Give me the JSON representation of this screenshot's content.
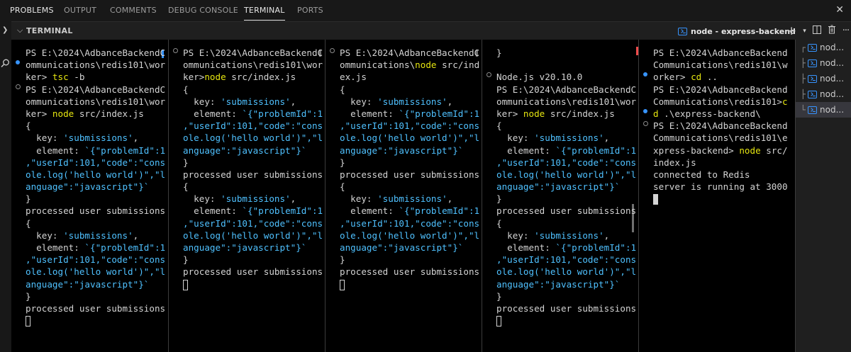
{
  "tabs": [
    "PROBLEMS",
    "OUTPUT",
    "COMMENTS",
    "DEBUG CONSOLE",
    "TERMINAL",
    "PORTS"
  ],
  "active_tab": "TERMINAL",
  "panel_title": "TERMINAL",
  "active_terminal": "node - express-backend",
  "terminal_list": [
    "nod...",
    "nod...",
    "nod...",
    "nod...",
    "nod..."
  ],
  "colors": {
    "accent": "#3794ff",
    "command": "#e5e510",
    "string": "#4fc1ff",
    "background": "#000000"
  },
  "panes": [
    {
      "lines": [
        [
          [
            "PS E:\\2024\\AdbanceBackendC",
            ""
          ]
        ],
        [
          [
            "ommunications\\redis101\\wor",
            ""
          ]
        ],
        [
          [
            "ker> ",
            ""
          ],
          [
            "tsc",
            "y"
          ],
          [
            " -b",
            ""
          ]
        ],
        [
          [
            "PS E:\\2024\\AdbanceBackendC",
            ""
          ]
        ],
        [
          [
            "ommunications\\redis101\\wor",
            ""
          ]
        ],
        [
          [
            "ker> ",
            ""
          ],
          [
            "node",
            "y"
          ],
          [
            " src/index.js",
            ""
          ]
        ],
        [
          [
            "{",
            ""
          ]
        ],
        [
          [
            "  key: ",
            ""
          ],
          [
            "'submissions'",
            "s"
          ],
          [
            ",",
            ""
          ]
        ],
        [
          [
            "  element: ",
            ""
          ],
          [
            "`{\"problemId\":1",
            "s"
          ]
        ],
        [
          [
            ",\"userId\":101,\"code\":\"cons",
            "s"
          ]
        ],
        [
          [
            "ole.log('hello world')\",\"l",
            "s"
          ]
        ],
        [
          [
            "anguage\":\"javascript\"}`",
            "s"
          ]
        ],
        [
          [
            "}",
            ""
          ]
        ],
        [
          [
            "processed user submissions",
            ""
          ]
        ],
        [
          [
            "{",
            ""
          ]
        ],
        [
          [
            "  key: ",
            ""
          ],
          [
            "'submissions'",
            "s"
          ],
          [
            ",",
            ""
          ]
        ],
        [
          [
            "  element: ",
            ""
          ],
          [
            "`{\"problemId\":1",
            "s"
          ]
        ],
        [
          [
            ",\"userId\":101,\"code\":\"cons",
            "s"
          ]
        ],
        [
          [
            "ole.log('hello world')\",\"l",
            "s"
          ]
        ],
        [
          [
            "anguage\":\"javascript\"}`",
            "s"
          ]
        ],
        [
          [
            "}",
            ""
          ]
        ],
        [
          [
            "processed user submissions",
            ""
          ]
        ]
      ]
    },
    {
      "lines": [
        [
          [
            "PS E:\\2024\\AdbanceBackendC",
            ""
          ]
        ],
        [
          [
            "ommunications\\redis101\\wor",
            ""
          ]
        ],
        [
          [
            "ker>",
            ""
          ],
          [
            "node",
            "y"
          ],
          [
            " src/index.js",
            ""
          ]
        ],
        [
          [
            "{",
            ""
          ]
        ],
        [
          [
            "  key: ",
            ""
          ],
          [
            "'submissions'",
            "s"
          ],
          [
            ",",
            ""
          ]
        ],
        [
          [
            "  element: ",
            ""
          ],
          [
            "`{\"problemId\":1",
            "s"
          ]
        ],
        [
          [
            ",\"userId\":101,\"code\":\"cons",
            "s"
          ]
        ],
        [
          [
            "ole.log('hello world')\",\"l",
            "s"
          ]
        ],
        [
          [
            "anguage\":\"javascript\"}`",
            "s"
          ]
        ],
        [
          [
            "}",
            ""
          ]
        ],
        [
          [
            "processed user submissions",
            ""
          ]
        ],
        [
          [
            "{",
            ""
          ]
        ],
        [
          [
            "  key: ",
            ""
          ],
          [
            "'submissions'",
            "s"
          ],
          [
            ",",
            ""
          ]
        ],
        [
          [
            "  element: ",
            ""
          ],
          [
            "`{\"problemId\":1",
            "s"
          ]
        ],
        [
          [
            ",\"userId\":101,\"code\":\"cons",
            "s"
          ]
        ],
        [
          [
            "ole.log('hello world')\",\"l",
            "s"
          ]
        ],
        [
          [
            "anguage\":\"javascript\"}`",
            "s"
          ]
        ],
        [
          [
            "}",
            ""
          ]
        ],
        [
          [
            "processed user submissions",
            ""
          ]
        ]
      ]
    },
    {
      "lines": [
        [
          [
            "PS E:\\2024\\AdbanceBackendC",
            ""
          ]
        ],
        [
          [
            "ommunications\\",
            ""
          ],
          [
            "node",
            "y"
          ],
          [
            " src/ind",
            ""
          ]
        ],
        [
          [
            "ex.js",
            ""
          ]
        ],
        [
          [
            "{",
            ""
          ]
        ],
        [
          [
            "  key: ",
            ""
          ],
          [
            "'submissions'",
            "s"
          ],
          [
            ",",
            ""
          ]
        ],
        [
          [
            "  element: ",
            ""
          ],
          [
            "`{\"problemId\":1",
            "s"
          ]
        ],
        [
          [
            ",\"userId\":101,\"code\":\"cons",
            "s"
          ]
        ],
        [
          [
            "ole.log('hello world')\",\"l",
            "s"
          ]
        ],
        [
          [
            "anguage\":\"javascript\"}`",
            "s"
          ]
        ],
        [
          [
            "}",
            ""
          ]
        ],
        [
          [
            "processed user submissions",
            ""
          ]
        ],
        [
          [
            "{",
            ""
          ]
        ],
        [
          [
            "  key: ",
            ""
          ],
          [
            "'submissions'",
            "s"
          ],
          [
            ",",
            ""
          ]
        ],
        [
          [
            "  element: ",
            ""
          ],
          [
            "`{\"problemId\":1",
            "s"
          ]
        ],
        [
          [
            ",\"userId\":101,\"code\":\"cons",
            "s"
          ]
        ],
        [
          [
            "ole.log('hello world')\",\"l",
            "s"
          ]
        ],
        [
          [
            "anguage\":\"javascript\"}`",
            "s"
          ]
        ],
        [
          [
            "}",
            ""
          ]
        ],
        [
          [
            "processed user submissions",
            ""
          ]
        ]
      ]
    },
    {
      "lines": [
        [
          [
            "}",
            ""
          ]
        ],
        [
          [
            "",
            ""
          ]
        ],
        [
          [
            "Node.js v20.10.0",
            ""
          ]
        ],
        [
          [
            "PS E:\\2024\\AdbanceBackendC",
            ""
          ]
        ],
        [
          [
            "ommunications\\redis101\\wor",
            ""
          ]
        ],
        [
          [
            "ker> ",
            ""
          ],
          [
            "node",
            "y"
          ],
          [
            " src/index.js",
            ""
          ]
        ],
        [
          [
            "{",
            ""
          ]
        ],
        [
          [
            "  key: ",
            ""
          ],
          [
            "'submissions'",
            "s"
          ],
          [
            ",",
            ""
          ]
        ],
        [
          [
            "  element: ",
            ""
          ],
          [
            "`{\"problemId\":1",
            "s"
          ]
        ],
        [
          [
            ",\"userId\":101,\"code\":\"cons",
            "s"
          ]
        ],
        [
          [
            "ole.log('hello world')\",\"l",
            "s"
          ]
        ],
        [
          [
            "anguage\":\"javascript\"}`",
            "s"
          ]
        ],
        [
          [
            "}",
            ""
          ]
        ],
        [
          [
            "processed user submissions",
            ""
          ]
        ],
        [
          [
            "{",
            ""
          ]
        ],
        [
          [
            "  key: ",
            ""
          ],
          [
            "'submissions'",
            "s"
          ],
          [
            ",",
            ""
          ]
        ],
        [
          [
            "  element: ",
            ""
          ],
          [
            "`{\"problemId\":1",
            "s"
          ]
        ],
        [
          [
            ",\"userId\":101,\"code\":\"cons",
            "s"
          ]
        ],
        [
          [
            "ole.log('hello world')\",\"l",
            "s"
          ]
        ],
        [
          [
            "anguage\":\"javascript\"}`",
            "s"
          ]
        ],
        [
          [
            "}",
            ""
          ]
        ],
        [
          [
            "processed user submissions",
            ""
          ]
        ]
      ]
    },
    {
      "lines": [
        [
          [
            "PS E:\\2024\\AdbanceBackend",
            ""
          ]
        ],
        [
          [
            "Communications\\redis101\\w",
            ""
          ]
        ],
        [
          [
            "orker> ",
            ""
          ],
          [
            "cd",
            "y"
          ],
          [
            " ..",
            ""
          ]
        ],
        [
          [
            "PS E:\\2024\\AdbanceBackend",
            ""
          ]
        ],
        [
          [
            "Communications\\redis101>",
            ""
          ],
          [
            "c",
            "y"
          ]
        ],
        [
          [
            "d",
            "y"
          ],
          [
            " .\\express-backend\\",
            ""
          ]
        ],
        [
          [
            "PS E:\\2024\\AdbanceBackend",
            ""
          ]
        ],
        [
          [
            "Communications\\redis101\\e",
            ""
          ]
        ],
        [
          [
            "xpress-backend> ",
            ""
          ],
          [
            "node",
            "y"
          ],
          [
            " src/",
            ""
          ]
        ],
        [
          [
            "index.js",
            ""
          ]
        ],
        [
          [
            "connected to Redis",
            ""
          ]
        ],
        [
          [
            "server is running at 3000",
            ""
          ]
        ]
      ]
    }
  ]
}
